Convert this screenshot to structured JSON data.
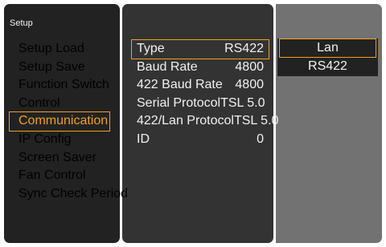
{
  "menu": {
    "title": "Setup",
    "items": [
      {
        "label": "Setup Load"
      },
      {
        "label": "Setup Save"
      },
      {
        "label": "Function Switch"
      },
      {
        "label": "Control"
      },
      {
        "label": "Communication"
      },
      {
        "label": "IP Config"
      },
      {
        "label": "Screen Saver"
      },
      {
        "label": "Fan Control"
      },
      {
        "label": "Sync Check Period"
      }
    ],
    "selected_index": 4
  },
  "settings": {
    "rows": [
      {
        "label": "Type",
        "value": "RS422"
      },
      {
        "label": "Baud Rate",
        "value": "4800"
      },
      {
        "label": "422 Baud Rate",
        "value": "4800"
      },
      {
        "label": "Serial Protocol",
        "value": "TSL 5.0"
      },
      {
        "label": "422/Lan Protocol",
        "value": "TSL 5.0"
      },
      {
        "label": "ID",
        "value": "0"
      }
    ],
    "selected_index": 0
  },
  "options": {
    "items": [
      {
        "label": "Lan"
      },
      {
        "label": "RS422"
      }
    ],
    "highlighted_index": 0
  },
  "colors": {
    "highlight": "#f0a020",
    "menu_bg": "#222222",
    "settings_bg": "#333333",
    "options_bg": "#727272"
  }
}
